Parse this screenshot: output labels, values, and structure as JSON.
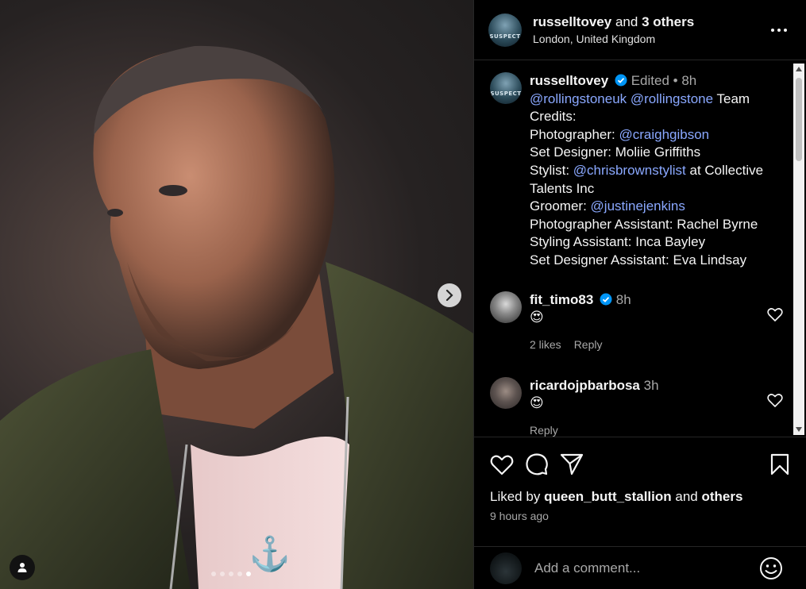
{
  "post": {
    "author": "russelltovey",
    "coauthors_joiner": "and",
    "coauthors": "3 others",
    "location": "London, United Kingdom",
    "avatar_text": "SUSPECT"
  },
  "caption": {
    "username": "russelltovey",
    "edited": "Edited",
    "dot": "•",
    "age": "8h",
    "mention1": "@rollingstoneuk",
    "mention2": "@rollingstone",
    "text1": "Team Credits:",
    "photographer_label": "Photographer:",
    "photographer": "@craighgibson",
    "set_designer": "Set Designer: Moliie Griffiths",
    "stylist_label": "Stylist:",
    "stylist": "@chrisbrownstylist",
    "stylist_suffix": "at Collective Talents Inc",
    "groomer_label": "Groomer:",
    "groomer": "@justinejenkins",
    "photo_assistant": "Photographer Assistant: Rachel Byrne",
    "styling_assistant": "Styling Assistant: Inca Bayley",
    "set_assistant": "Set Designer Assistant: Eva Lindsay"
  },
  "comments": [
    {
      "username": "fit_timo83",
      "age": "8h",
      "text": "😍",
      "likes": "2 likes",
      "reply": "Reply"
    },
    {
      "username": "ricardojpbarbosa",
      "age": "3h",
      "text": "😍",
      "reply": "Reply"
    }
  ],
  "likes_line": {
    "prefix": "Liked by",
    "user": "queen_butt_stallion",
    "joiner": "and",
    "others": "others"
  },
  "timestamp": "9 hours ago",
  "add_comment": {
    "placeholder": "Add a comment..."
  },
  "carousel": {
    "count": 5,
    "active_index": 4
  },
  "colors": {
    "link": "#8aa8ff",
    "verified": "#0095f6",
    "background": "#000000"
  }
}
